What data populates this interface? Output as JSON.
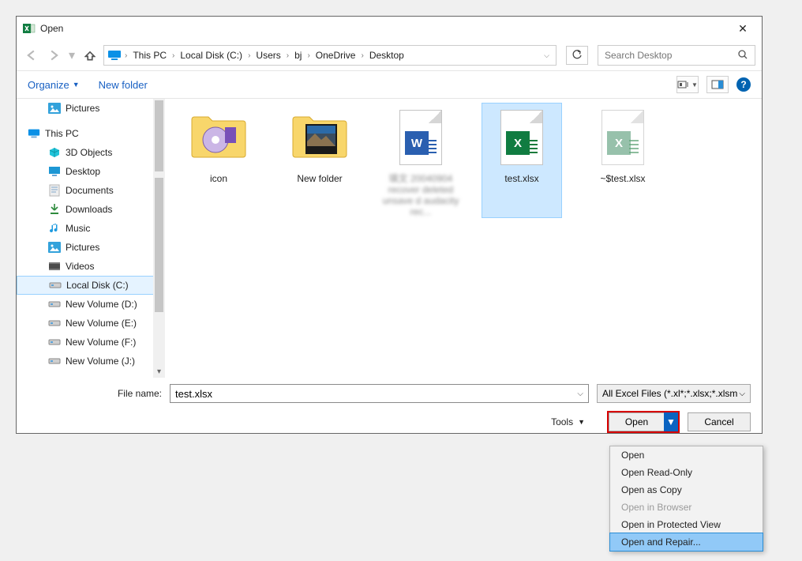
{
  "window": {
    "title": "Open"
  },
  "breadcrumb": {
    "root_icon": "monitor",
    "parts": [
      "This PC",
      "Local Disk (C:)",
      "Users",
      "bj",
      "OneDrive",
      "Desktop"
    ]
  },
  "search": {
    "placeholder": "Search Desktop"
  },
  "toolbar": {
    "organize": "Organize",
    "newfolder": "New folder",
    "help": "?"
  },
  "sidebar": {
    "items": [
      {
        "label": "Pictures",
        "icon": "pictures",
        "indent": 1
      },
      {
        "label": "",
        "icon": "",
        "spacer": true
      },
      {
        "label": "This PC",
        "icon": "thispc",
        "indent": 0
      },
      {
        "label": "3D Objects",
        "icon": "3d",
        "indent": 1
      },
      {
        "label": "Desktop",
        "icon": "desktop",
        "indent": 1
      },
      {
        "label": "Documents",
        "icon": "documents",
        "indent": 1
      },
      {
        "label": "Downloads",
        "icon": "downloads",
        "indent": 1
      },
      {
        "label": "Music",
        "icon": "music",
        "indent": 1
      },
      {
        "label": "Pictures",
        "icon": "pictures",
        "indent": 1
      },
      {
        "label": "Videos",
        "icon": "videos",
        "indent": 1
      },
      {
        "label": "Local Disk (C:)",
        "icon": "drive",
        "indent": 1,
        "selected": true
      },
      {
        "label": "New Volume (D:)",
        "icon": "drive",
        "indent": 1
      },
      {
        "label": "New Volume (E:)",
        "icon": "drive",
        "indent": 1
      },
      {
        "label": "New Volume (F:)",
        "icon": "drive",
        "indent": 1
      },
      {
        "label": "New Volume (J:)",
        "icon": "drive",
        "indent": 1
      }
    ]
  },
  "files": {
    "items": [
      {
        "label": "icon",
        "kind": "folder-purple"
      },
      {
        "label": "New folder",
        "kind": "folder-photo"
      },
      {
        "label": "填文\n20040904 recover deleted unsave d audacity rec...",
        "kind": "word",
        "blurred": true
      },
      {
        "label": "test.xlsx",
        "kind": "excel",
        "selected": true
      },
      {
        "label": "~$test.xlsx",
        "kind": "excel-temp"
      }
    ]
  },
  "footer": {
    "filename_label": "File name:",
    "filename_value": "test.xlsx",
    "filter": "All Excel Files (*.xl*;*.xlsx;*.xlsm",
    "tools": "Tools",
    "open": "Open",
    "cancel": "Cancel"
  },
  "menu": {
    "items": [
      {
        "label": "Open"
      },
      {
        "label": "Open Read-Only"
      },
      {
        "label": "Open as Copy"
      },
      {
        "label": "Open in Browser",
        "disabled": true
      },
      {
        "label": "Open in Protected View"
      },
      {
        "label": "Open and Repair...",
        "hover": true
      }
    ]
  }
}
